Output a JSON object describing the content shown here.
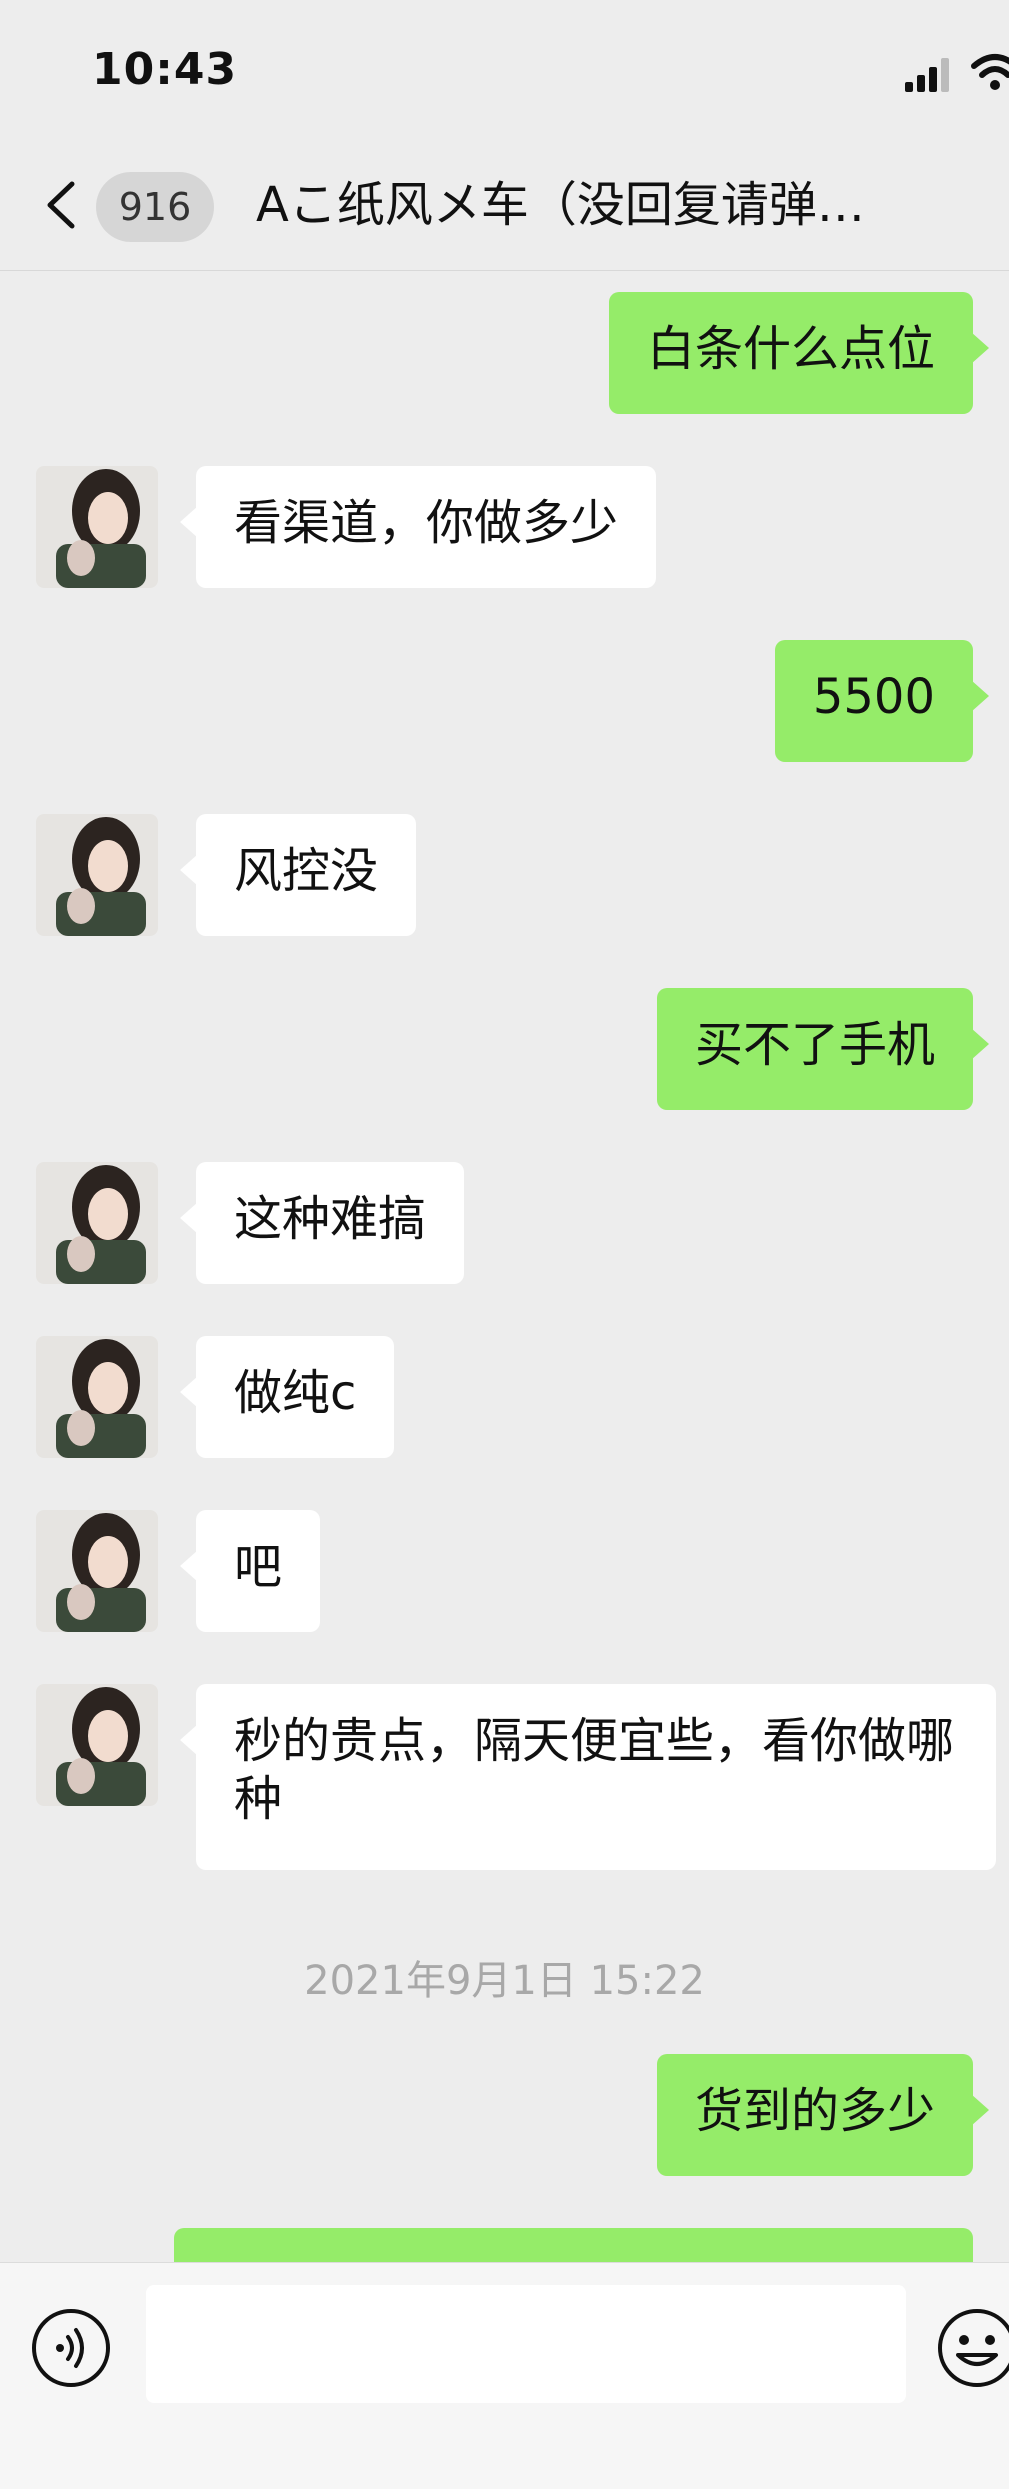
{
  "status_bar": {
    "time": "10:43"
  },
  "header": {
    "unread_count": "916",
    "title": "Aこ纸风メ车（没回复请弹…"
  },
  "messages": [
    {
      "side": "out",
      "text": "白条什么点位"
    },
    {
      "side": "in",
      "text": "看渠道，你做多少"
    },
    {
      "side": "out",
      "text": "5500"
    },
    {
      "side": "in",
      "text": "风控没"
    },
    {
      "side": "out",
      "text": "买不了手机"
    },
    {
      "side": "in",
      "text": "这种难搞"
    },
    {
      "side": "in",
      "text": "做纯c"
    },
    {
      "side": "in",
      "text": "吧"
    },
    {
      "side": "in",
      "text": "秒的贵点，隔天便宜些，看你做哪种"
    },
    {
      "side": "out",
      "text": "货到的多少"
    },
    {
      "side": "out",
      "text": ""
    }
  ],
  "timestamp": "2021年9月1日 15:22",
  "input": {
    "value": ""
  },
  "colors": {
    "outgoing_bubble": "#95ec69",
    "incoming_bubble": "#ffffff",
    "background": "#ededed"
  },
  "icons": [
    "signal-icon",
    "wifi-icon",
    "back-icon",
    "voice-icon",
    "emoji-icon"
  ]
}
